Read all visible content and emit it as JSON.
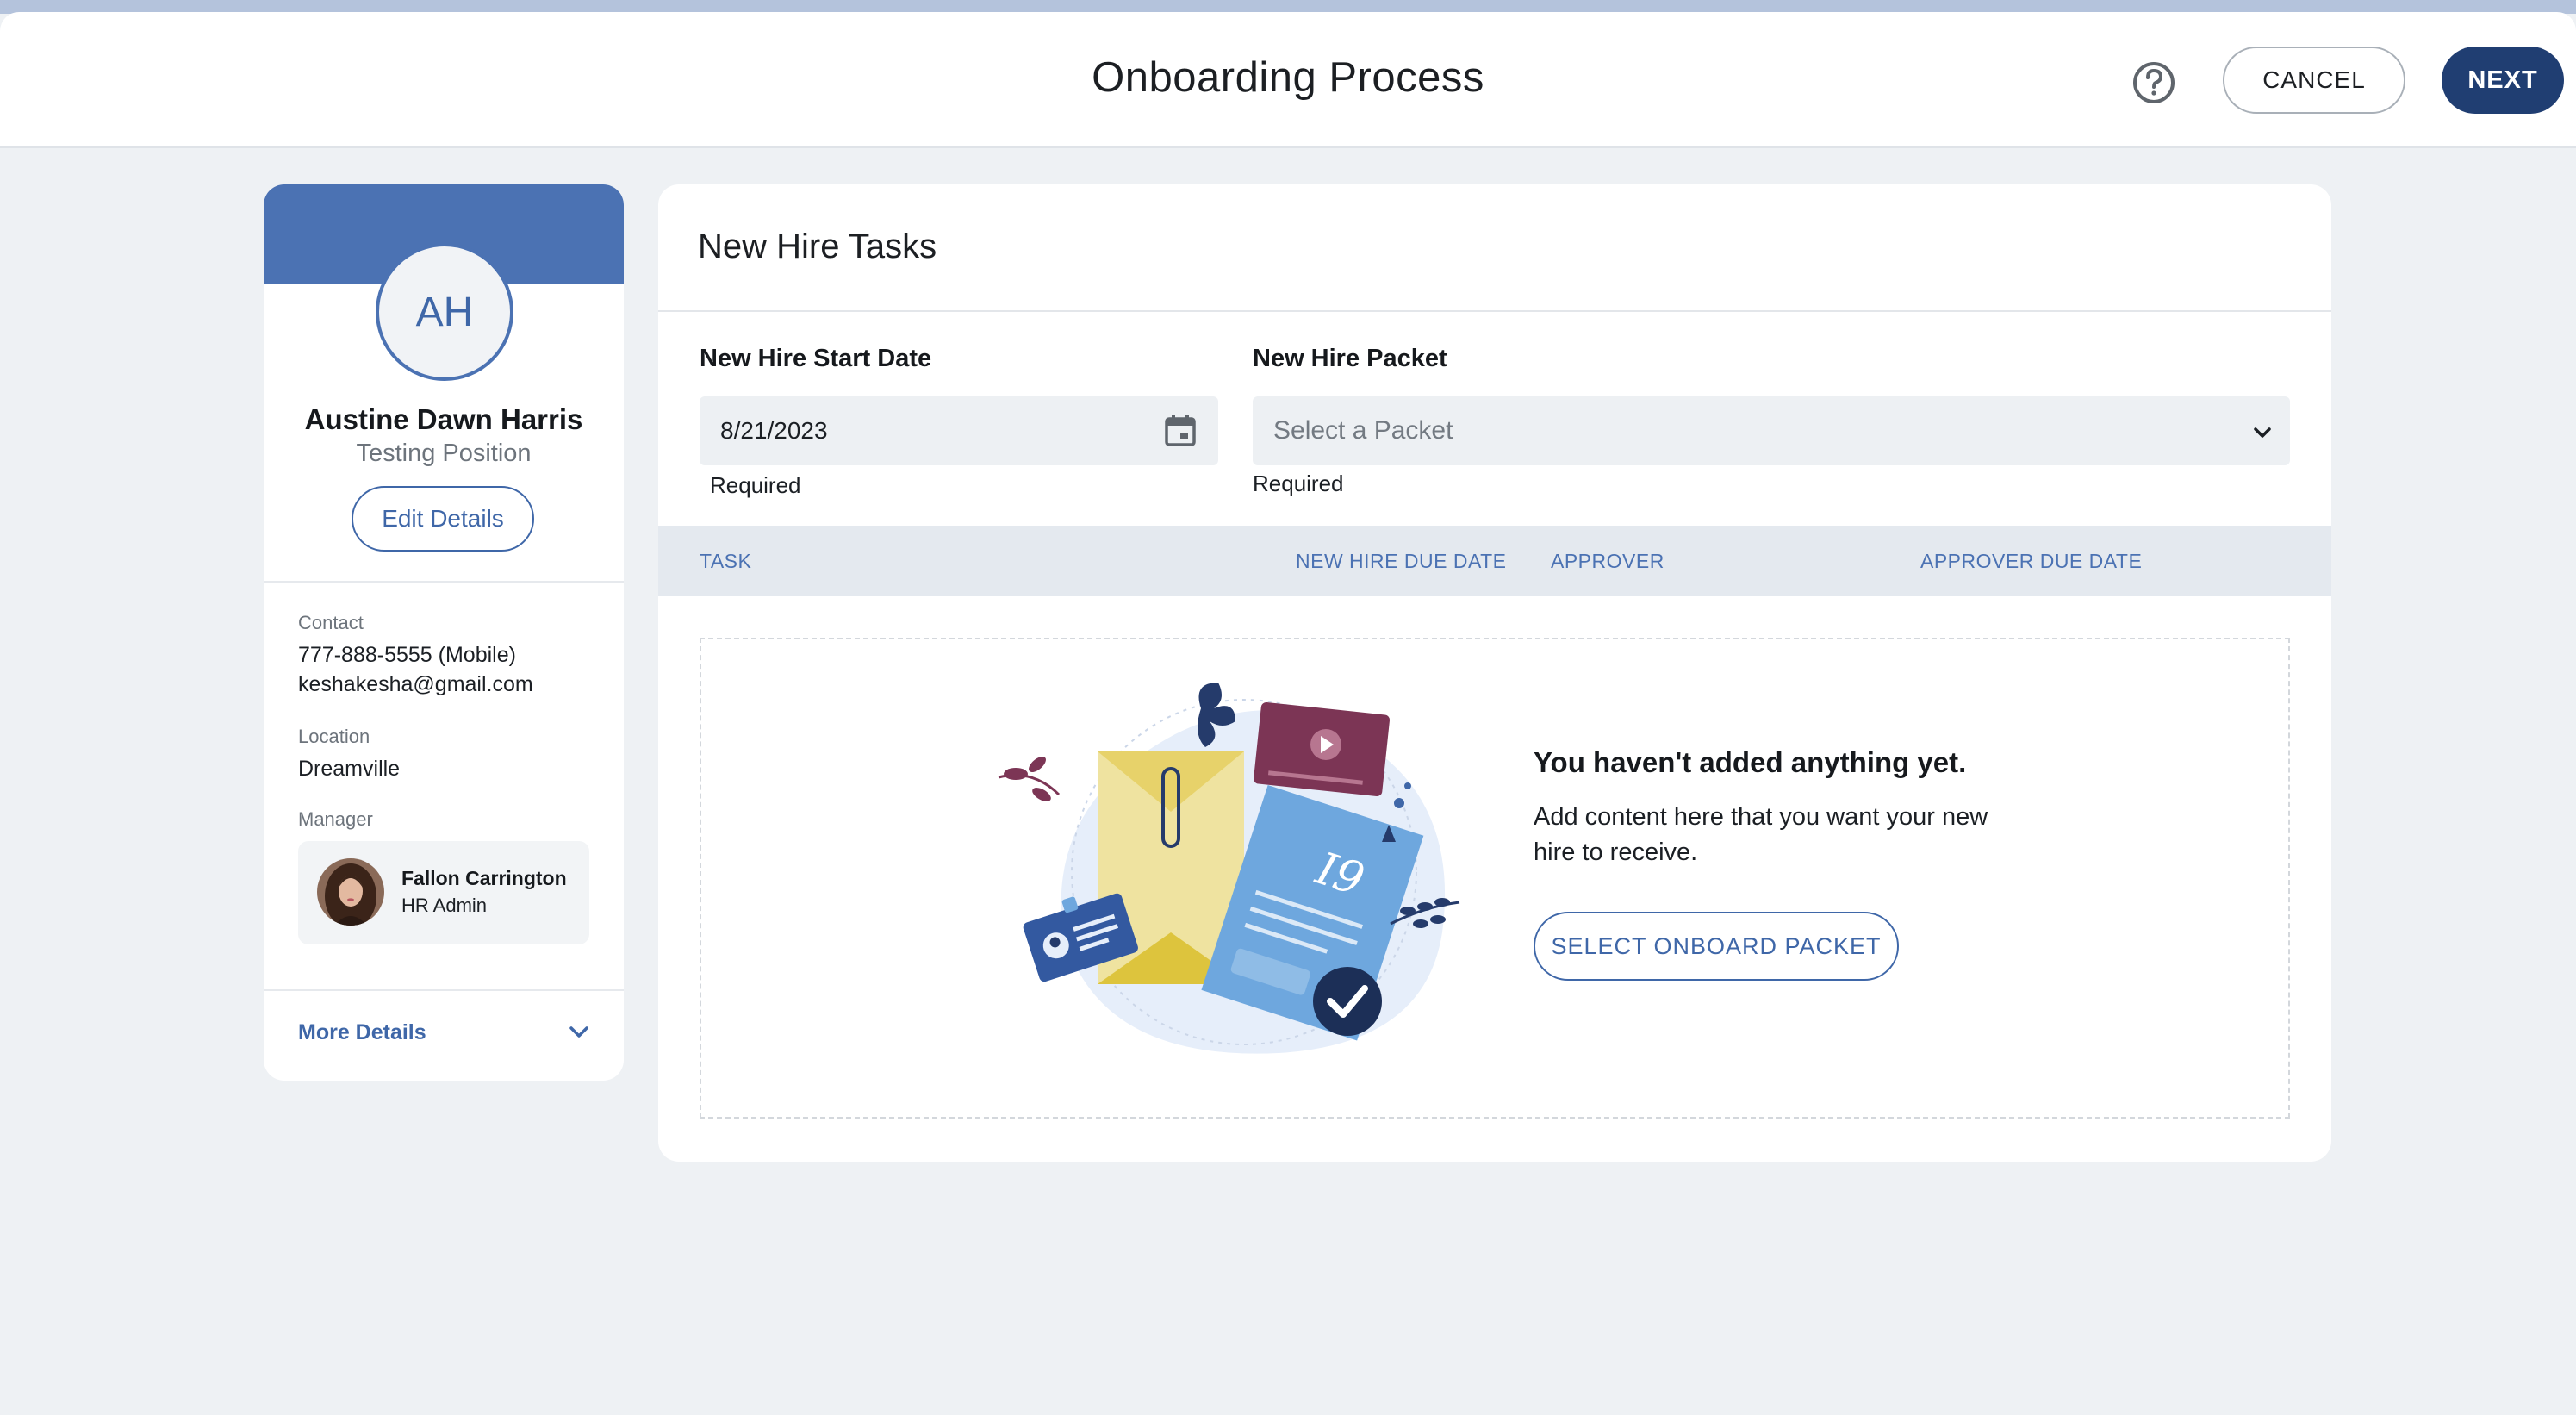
{
  "header": {
    "title": "Onboarding Process",
    "cancel_label": "CANCEL",
    "next_label": "NEXT"
  },
  "profile": {
    "initials": "AH",
    "name": "Austine Dawn Harris",
    "position": "Testing Position",
    "edit_label": "Edit Details",
    "contact_label": "Contact",
    "phone": "777-888-5555 (Mobile)",
    "email": "keshakesha@gmail.com",
    "location_label": "Location",
    "location": "Dreamville",
    "manager_label": "Manager",
    "manager_name": "Fallon Carrington",
    "manager_role": "HR Admin",
    "more_details_label": "More Details"
  },
  "tasks": {
    "title": "New Hire Tasks",
    "start_date_label": "New Hire Start Date",
    "start_date_value": "8/21/2023",
    "start_date_required": "Required",
    "packet_label": "New Hire Packet",
    "packet_placeholder": "Select a Packet",
    "packet_required": "Required",
    "columns": [
      "TASK",
      "NEW HIRE DUE DATE",
      "APPROVER",
      "APPROVER DUE DATE"
    ],
    "empty_title": "You haven't added anything yet.",
    "empty_description": "Add content here that you want your new hire to receive.",
    "select_packet_label": "SELECT ONBOARD PACKET"
  },
  "illustration": {
    "document_label": "I9"
  },
  "colors": {
    "primary": "#203e72",
    "accent": "#4b72b3",
    "background": "#eef1f4"
  }
}
